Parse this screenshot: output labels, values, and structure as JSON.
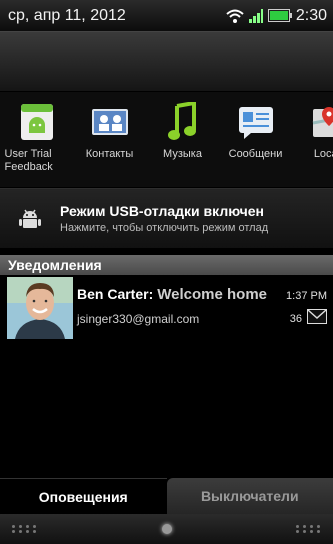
{
  "status_bar": {
    "date": "ср, апр 11, 2012",
    "time": "2:30",
    "icons": [
      "wifi-icon",
      "signal-icon",
      "battery-icon"
    ]
  },
  "apps": [
    {
      "label": "User Trial Feedback",
      "icon": "android-feedback-icon"
    },
    {
      "label": "Контакты",
      "icon": "contacts-icon"
    },
    {
      "label": "Музыка",
      "icon": "music-note-icon"
    },
    {
      "label": "Сообщени",
      "icon": "messages-icon"
    },
    {
      "label": "Locati",
      "icon": "location-icon"
    }
  ],
  "usb_debug": {
    "title": "Режим USB-отладки включен",
    "subtitle": "Нажмите, чтобы отключить режим отлад",
    "icon": "android-debug-icon"
  },
  "notifications_header": "Уведомления",
  "notifications": [
    {
      "sender": "Ben Carter:",
      "subject": "Welcome home",
      "time": "1:37 PM",
      "account": "jsinger330@gmail.com",
      "count": "36",
      "icon": "mail-icon"
    }
  ],
  "tabs": {
    "alerts": "Оповещения",
    "switches": "Выключатели"
  },
  "colors": {
    "battery": "#2ecc40",
    "music": "#8bd12a"
  }
}
